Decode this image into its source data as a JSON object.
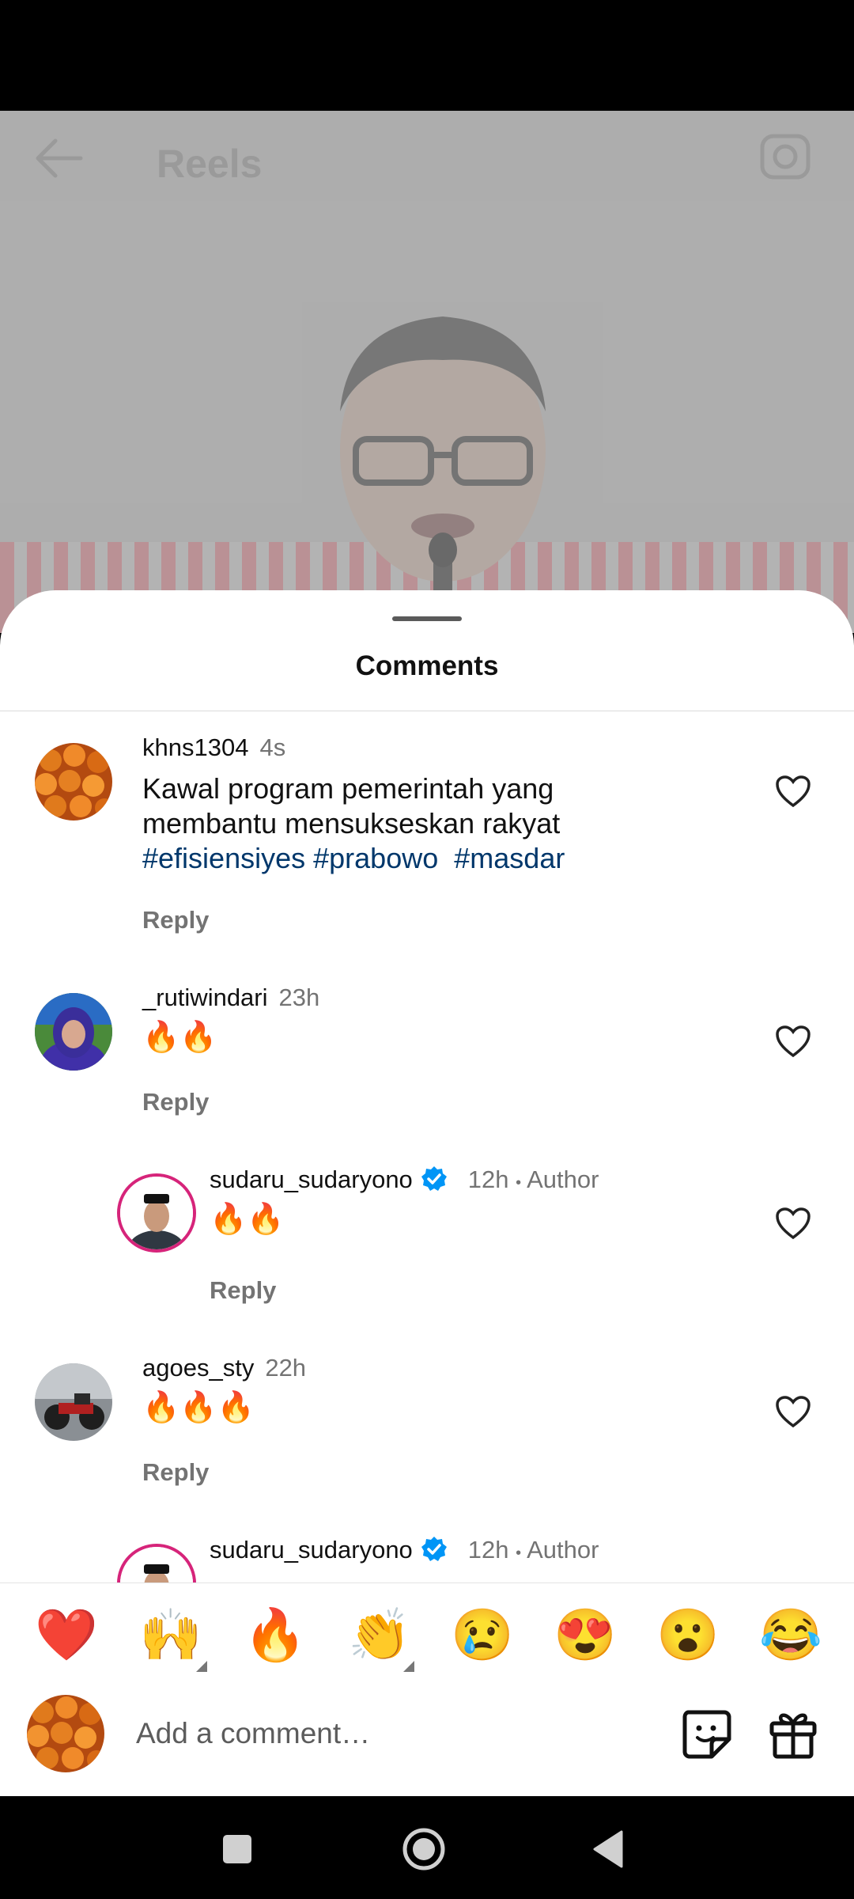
{
  "header": {
    "title": "Reels"
  },
  "sheet": {
    "title": "Comments"
  },
  "comments": [
    {
      "username": "khns1304",
      "time": "4s",
      "text_plain": "Kawal program pemerintah yang membantu mensukseskan rakyat",
      "hashtags": [
        "#efisiensiyes",
        "#prabowo",
        "#masdar"
      ],
      "reply_label": "Reply"
    },
    {
      "username": "_rutiwindari",
      "time": "23h",
      "text": "🔥🔥",
      "reply_label": "Reply"
    },
    {
      "username": "sudaru_sudaryono",
      "time": "12h",
      "separator": "•",
      "badge": "Author",
      "text": "🔥🔥",
      "reply_label": "Reply",
      "verified": true
    },
    {
      "username": "agoes_sty",
      "time": "22h",
      "text": "🔥🔥🔥",
      "reply_label": "Reply"
    },
    {
      "username": "sudaru_sudaryono",
      "time": "12h",
      "separator": "•",
      "badge": "Author",
      "verified": true
    }
  ],
  "reactions": [
    {
      "emoji": "❤️",
      "name": "red-heart"
    },
    {
      "emoji": "🙌",
      "name": "raising-hands"
    },
    {
      "emoji": "🔥",
      "name": "fire"
    },
    {
      "emoji": "👏",
      "name": "clapping-hands"
    },
    {
      "emoji": "😢",
      "name": "crying-face"
    },
    {
      "emoji": "😍",
      "name": "heart-eyes"
    },
    {
      "emoji": "😮",
      "name": "open-mouth"
    },
    {
      "emoji": "😂",
      "name": "tears-of-joy"
    }
  ],
  "input": {
    "placeholder": "Add a comment…"
  },
  "colors": {
    "accent_link": "#00376b",
    "verified": "#0095f6",
    "story_ring": "#d6247a",
    "muted": "#737373"
  }
}
